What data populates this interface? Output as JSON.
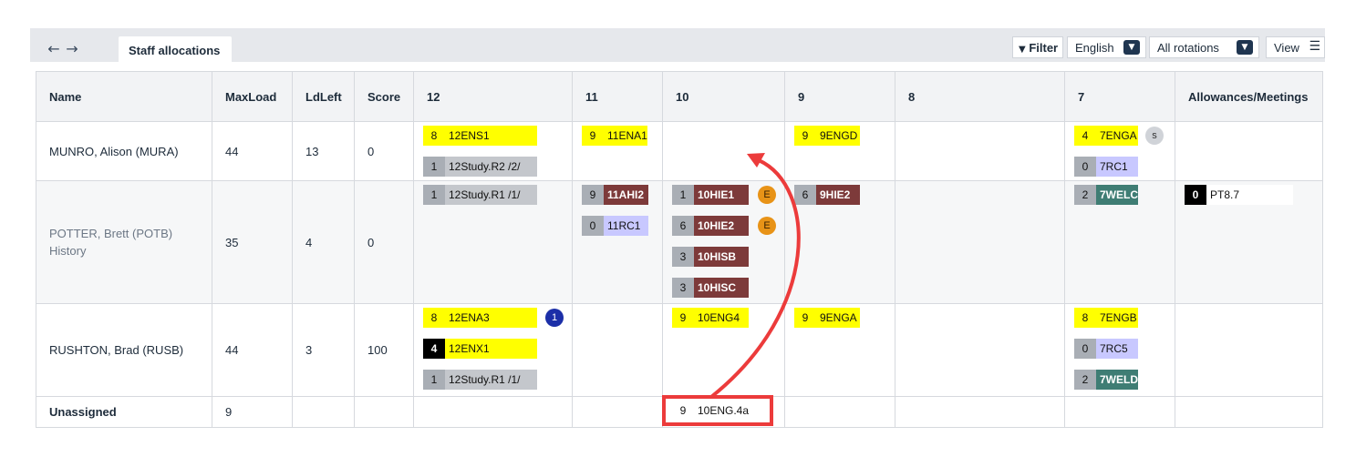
{
  "header": {
    "back_icon": "arrow-left-icon",
    "forward_icon": "arrow-right-icon",
    "tab_label": "Staff allocations",
    "filter_label": "Filter",
    "language_value": "English",
    "rotation_value": "All rotations",
    "view_label": "View"
  },
  "columns": {
    "name": "Name",
    "maxload": "MaxLoad",
    "ldleft": "LdLeft",
    "score": "Score",
    "y12": "12",
    "y11": "11",
    "y10": "10",
    "y9": "9",
    "y8": "8",
    "y7": "7",
    "allowances": "Allowances/Meetings"
  },
  "rows": {
    "munro": {
      "name": "MUNRO, Alison  (MURA)",
      "maxload": "44",
      "ldleft": "13",
      "score": "0",
      "y12": [
        {
          "n": "8",
          "code": "12ENS1"
        },
        {
          "n": "1",
          "code": "12Study.R2 /2/"
        }
      ],
      "y11": [
        {
          "n": "9",
          "code": "11ENA1"
        }
      ],
      "y9": [
        {
          "n": "9",
          "code": "9ENGD"
        }
      ],
      "y7": [
        {
          "n": "4",
          "code": "7ENGA"
        },
        {
          "n": "0",
          "code": "7RC1"
        }
      ],
      "y7_badge": "s"
    },
    "potter": {
      "name": "POTTER, Brett  (POTB)",
      "subtitle": "History",
      "maxload": "35",
      "ldleft": "4",
      "score": "0",
      "y12": [
        {
          "n": "1",
          "code": "12Study.R1 /1/"
        }
      ],
      "y11": [
        {
          "n": "9",
          "code": "11AHI2"
        },
        {
          "n": "0",
          "code": "11RC1"
        }
      ],
      "y10": [
        {
          "n": "1",
          "code": "10HIE1"
        },
        {
          "n": "6",
          "code": "10HIE2"
        },
        {
          "n": "3",
          "code": "10HISB"
        },
        {
          "n": "3",
          "code": "10HISC"
        }
      ],
      "y10_badge": "E",
      "y9": [
        {
          "n": "6",
          "code": "9HIE2"
        }
      ],
      "y7": [
        {
          "n": "2",
          "code": "7WELC"
        }
      ],
      "allowances": [
        {
          "n": "0",
          "code": "PT8.7"
        }
      ]
    },
    "rushton": {
      "name": "RUSHTON, Brad  (RUSB)",
      "maxload": "44",
      "ldleft": "3",
      "score": "100",
      "y12": [
        {
          "n": "8",
          "code": "12ENA3"
        },
        {
          "n": "4",
          "code": "12ENX1"
        },
        {
          "n": "1",
          "code": "12Study.R1 /1/"
        }
      ],
      "y12_badge": "1",
      "y10": [
        {
          "n": "9",
          "code": "10ENG4"
        }
      ],
      "y9": [
        {
          "n": "9",
          "code": "9ENGA"
        }
      ],
      "y7": [
        {
          "n": "8",
          "code": "7ENGB"
        },
        {
          "n": "0",
          "code": "7RC5"
        },
        {
          "n": "2",
          "code": "7WELD"
        }
      ]
    },
    "unassigned": {
      "name": "Unassigned",
      "maxload": "9",
      "y10": [
        {
          "n": "9",
          "code": "10ENG.4a"
        }
      ]
    }
  },
  "colors": {
    "yellow": "#ffff00",
    "grey": "#c4c7cc",
    "lavender": "#c8c8ff",
    "maroon": "#7d3a3a",
    "teal": "#3f7d74",
    "annotation_red": "#ec3b3b"
  }
}
